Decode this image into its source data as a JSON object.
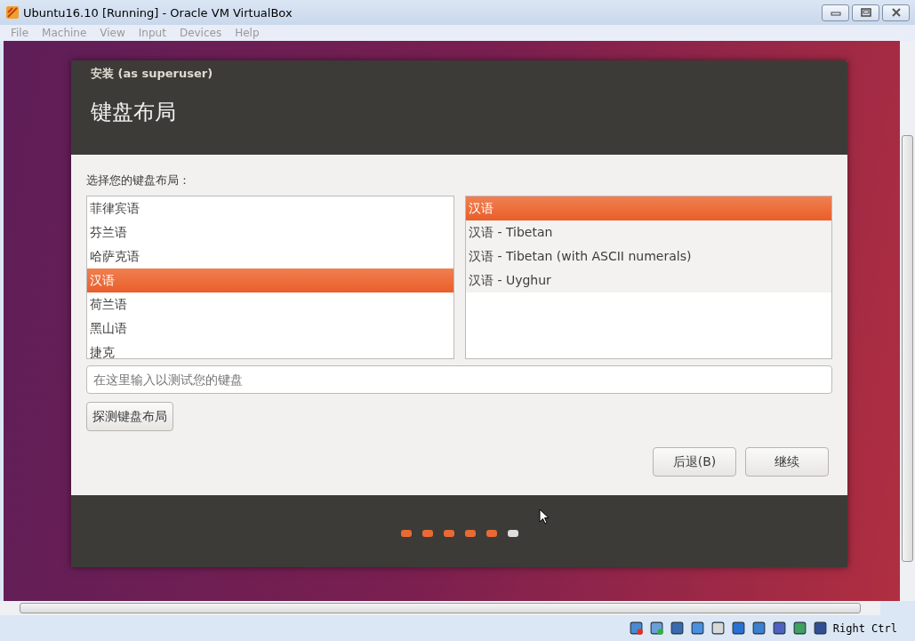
{
  "window": {
    "title": "Ubuntu16.10 [Running] - Oracle VM VirtualBox"
  },
  "menu": [
    "File",
    "Machine",
    "View",
    "Input",
    "Devices",
    "Help"
  ],
  "installer": {
    "window_title": "安装 (as superuser)",
    "heading": "键盘布局",
    "prompt": "选择您的键盘布局：",
    "layouts": [
      {
        "label": "菲律宾语",
        "selected": false
      },
      {
        "label": "芬兰语",
        "selected": false
      },
      {
        "label": "哈萨克语",
        "selected": false
      },
      {
        "label": "汉语",
        "selected": true
      },
      {
        "label": "荷兰语",
        "selected": false
      },
      {
        "label": "黑山语",
        "selected": false
      },
      {
        "label": "捷克",
        "selected": false
      }
    ],
    "variants": [
      {
        "label": "汉语",
        "selected": true
      },
      {
        "label": "汉语 - Tibetan",
        "selected": false
      },
      {
        "label": "汉语 - Tibetan (with ASCII numerals)",
        "selected": false
      },
      {
        "label": "汉语 - Uyghur",
        "selected": false
      }
    ],
    "test_field": {
      "placeholder": "在这里输入以测试您的键盘"
    },
    "detect_button": "探测键盘布局",
    "buttons": [
      "后退(B)",
      "继续"
    ],
    "steps": [
      {
        "completed": true
      },
      {
        "completed": true
      },
      {
        "completed": true
      },
      {
        "completed": true
      },
      {
        "completed": true
      },
      {
        "completed": false
      }
    ]
  },
  "status_bar": {
    "host_key": "Right Ctrl"
  }
}
